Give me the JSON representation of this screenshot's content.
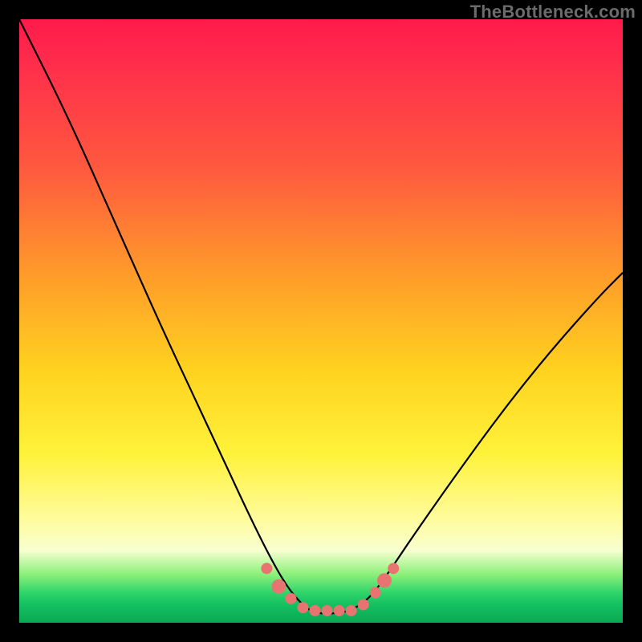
{
  "watermark": {
    "text": "TheBottleneck.com"
  },
  "chart_data": {
    "type": "line",
    "title": "",
    "xlabel": "",
    "ylabel": "",
    "xlim": [
      0,
      100
    ],
    "ylim": [
      0,
      100
    ],
    "series": [
      {
        "name": "bottleneck-curve",
        "x": [
          0,
          8,
          16,
          24,
          32,
          38,
          42,
          45,
          48,
          50,
          52,
          55,
          58,
          61,
          65,
          72,
          80,
          88,
          96,
          100
        ],
        "values": [
          100,
          84,
          66,
          48,
          31,
          18,
          10,
          5,
          2,
          1.5,
          1.5,
          2,
          4,
          8,
          14,
          24,
          35,
          45,
          54,
          58
        ]
      }
    ],
    "markers": [
      {
        "x": 41,
        "y": 9,
        "size": 7
      },
      {
        "x": 43,
        "y": 6,
        "size": 9
      },
      {
        "x": 45,
        "y": 4,
        "size": 7
      },
      {
        "x": 47,
        "y": 2.5,
        "size": 7
      },
      {
        "x": 49,
        "y": 2,
        "size": 7
      },
      {
        "x": 51,
        "y": 2,
        "size": 7
      },
      {
        "x": 53,
        "y": 2,
        "size": 7
      },
      {
        "x": 55,
        "y": 2,
        "size": 7
      },
      {
        "x": 57,
        "y": 3,
        "size": 7
      },
      {
        "x": 59,
        "y": 5,
        "size": 7
      },
      {
        "x": 60.5,
        "y": 7,
        "size": 9
      },
      {
        "x": 62,
        "y": 9,
        "size": 7
      }
    ],
    "colors": {
      "curve": "#000000",
      "marker": "#e97371"
    }
  }
}
